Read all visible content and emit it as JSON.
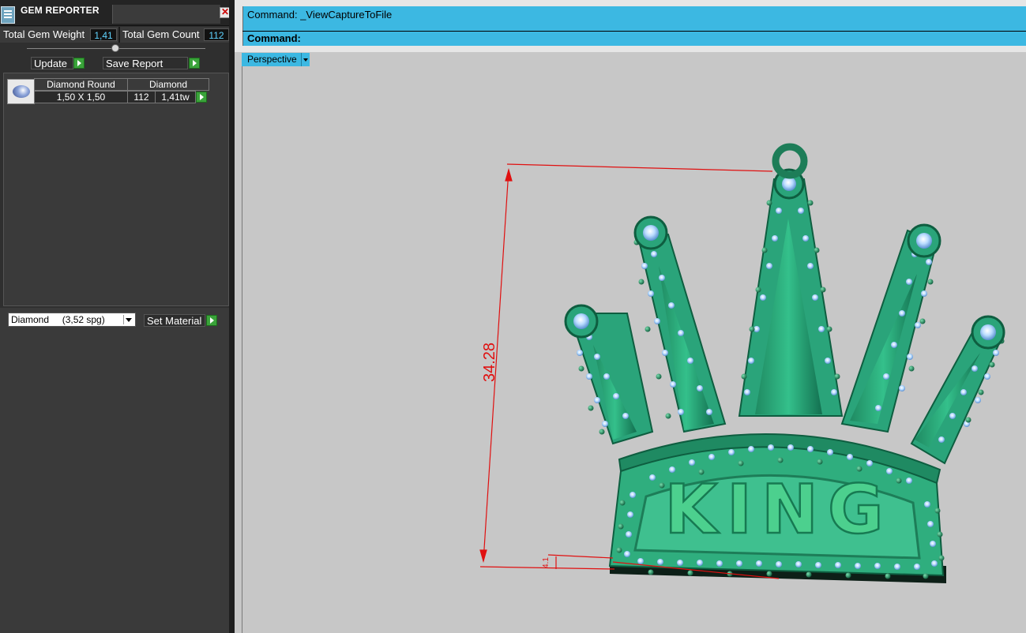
{
  "app": {
    "panel_title": "GEM REPORTER",
    "close_glyph": "✕"
  },
  "summary": {
    "weight_label": "Total Gem Weight",
    "weight_value": "1,41",
    "count_label": "Total Gem Count",
    "count_value": "112"
  },
  "actions": {
    "update_label": "Update",
    "save_label": "Save Report"
  },
  "gem_row": {
    "shape_header": "Diamond Round",
    "material_header": "Diamond",
    "size": "1,50 X 1,50",
    "count": "112",
    "weight": "1,41tw"
  },
  "material": {
    "selected": "Diamond     (3,52 spg)",
    "set_label": "Set Material"
  },
  "command": {
    "history": "Command:  _ViewCaptureToFile",
    "prompt": "Command:"
  },
  "viewport": {
    "name": "Perspective",
    "dimension_label": "34.28",
    "small_dimension": "4.1",
    "model_text": "KING"
  },
  "colors": {
    "accent": "#3cb8e2",
    "model_green": "#2fae7e",
    "gem_blue": "#a9d3ff",
    "dimension_red": "#e01010"
  }
}
